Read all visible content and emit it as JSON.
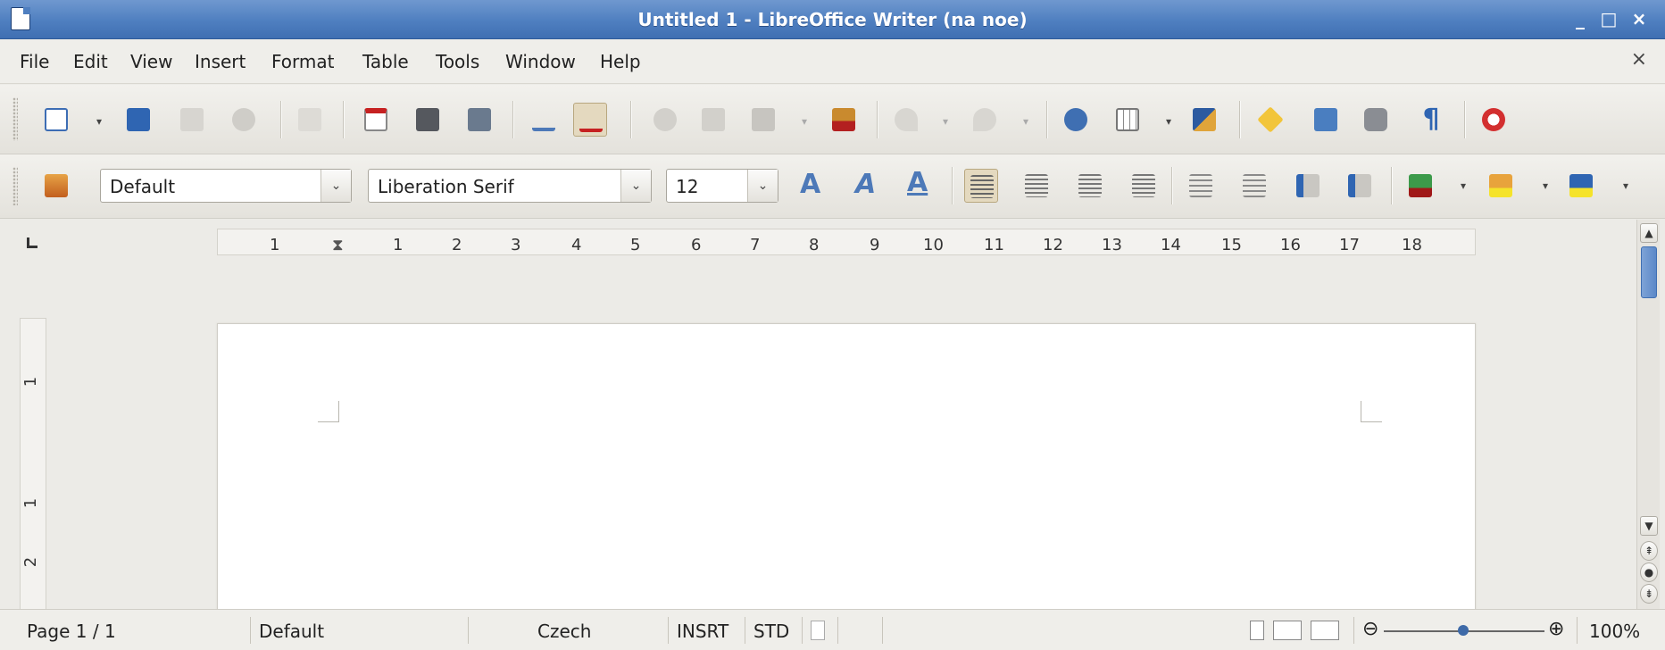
{
  "window": {
    "title": "Untitled 1 - LibreOffice Writer (na noe)",
    "controls": [
      "_",
      "□",
      "×"
    ]
  },
  "menubar": {
    "items": [
      "File",
      "Edit",
      "View",
      "Insert",
      "Format",
      "Table",
      "Tools",
      "Window",
      "Help"
    ],
    "close_doc": "×"
  },
  "format_toolbar": {
    "paragraph_style": "Default",
    "font_name": "Liberation Serif",
    "font_size": "12"
  },
  "ruler": {
    "ticks": [
      "1",
      "1",
      "2",
      "3",
      "4",
      "5",
      "6",
      "7",
      "8",
      "9",
      "10",
      "11",
      "12",
      "13",
      "14",
      "15",
      "16",
      "17",
      "18"
    ],
    "vertical_ticks": [
      "1",
      "1",
      "2"
    ]
  },
  "statusbar": {
    "page": "Page 1 / 1",
    "page_style": "Default",
    "language": "Czech",
    "insert_mode": "INSRT",
    "selection_mode": "STD",
    "zoom": "100%"
  },
  "colors": {
    "titlebar": "#4f7fc0",
    "accent": "#4d79b8"
  }
}
